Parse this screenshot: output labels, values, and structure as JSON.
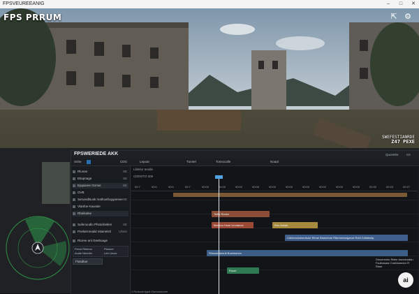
{
  "window": {
    "title": "FPSVEUREEANIG",
    "minimize_icon": "minimize-icon",
    "maximize_icon": "maximize-icon",
    "close_icon": "close-icon"
  },
  "game": {
    "title": "FPS PRRUM",
    "hud_icons": [
      "share-icon",
      "gear-icon"
    ],
    "readout_top": "SWEFESTIANRDE",
    "readout_sub": "Z47 PEXE"
  },
  "editor": {
    "title": "FPSWERIEDE AKK",
    "header_buttons": [
      "Quonelre",
      "Ce"
    ],
    "toolbar": [
      "Snhe",
      "CDG",
      "Lepoar",
      "Tunnel",
      "Tosnocalle",
      "Noaal"
    ],
    "timeline_label": "Liblelur Ieodle",
    "timeline_sublabel": "CDDOTO 005",
    "ruler_ticks": [
      "00:7",
      "00:0",
      "00:0",
      "00:7",
      "00:00",
      "00:00",
      "00:02",
      "00:06",
      "00:00",
      "00:00",
      "00:00",
      "00:02",
      "00:00",
      "00:00",
      "00:42",
      "00:23",
      "00:27"
    ],
    "sidebar": {
      "rows": [
        {
          "label": "Rlunan",
          "tag": "SE"
        },
        {
          "label": "Eluqmage",
          "tag": "SE"
        },
        {
          "label": "Ejupanee Gomie",
          "tag": "SE"
        },
        {
          "label": "OVB",
          "tag": ""
        },
        {
          "label": "Seruredlsusk  mathoafraygoesee",
          "tag": "SE"
        },
        {
          "label": "Vlanfoe Kaunsle",
          "tag": ""
        },
        {
          "label": "Rbeikalee",
          "tag": ""
        },
        {
          "label": "Sufenoudlo Phstorbetlen",
          "tag": "SE"
        },
        {
          "label": "Pnelarmmalid mlamelstl",
          "tag": "Uhelo"
        },
        {
          "label": "Rtoree anl Geeboage",
          "tag": ""
        }
      ],
      "card": {
        "left_1": "Pexol Relemo",
        "left_2": "Avale Nhonler",
        "right_1": "Plaoner",
        "right_2": "Leb Lieow"
      },
      "button": "Ftasdtue"
    },
    "clips": [
      {
        "label": "",
        "color": "#7a5a35"
      },
      {
        "label": "Tslho Ranko",
        "color": "#8a4d37"
      },
      {
        "label": "Beneoo Hose Unotanne",
        "color": "#9b4a36"
      },
      {
        "label": "Ebo Asbah",
        "color": "#a58a3e"
      },
      {
        "label": "Cdnienolodsedkoor Rlnne Brsinehoe Rlkrrenmarganor Robl Cdlldesdy",
        "color": "#3f5f8c"
      },
      {
        "label": "Rlnusdndonnlt Bostmoneo",
        "color": "#3b5d86"
      },
      {
        "label": "Riuob",
        "color": "#2f7a52"
      }
    ],
    "note": "Dinoenmiro Rbbrr Asneinoddu Fsulbosaar Coebbamdor R Rlme",
    "footer": "1 Rodouenigad Clunomnoere"
  },
  "badge": "ai"
}
